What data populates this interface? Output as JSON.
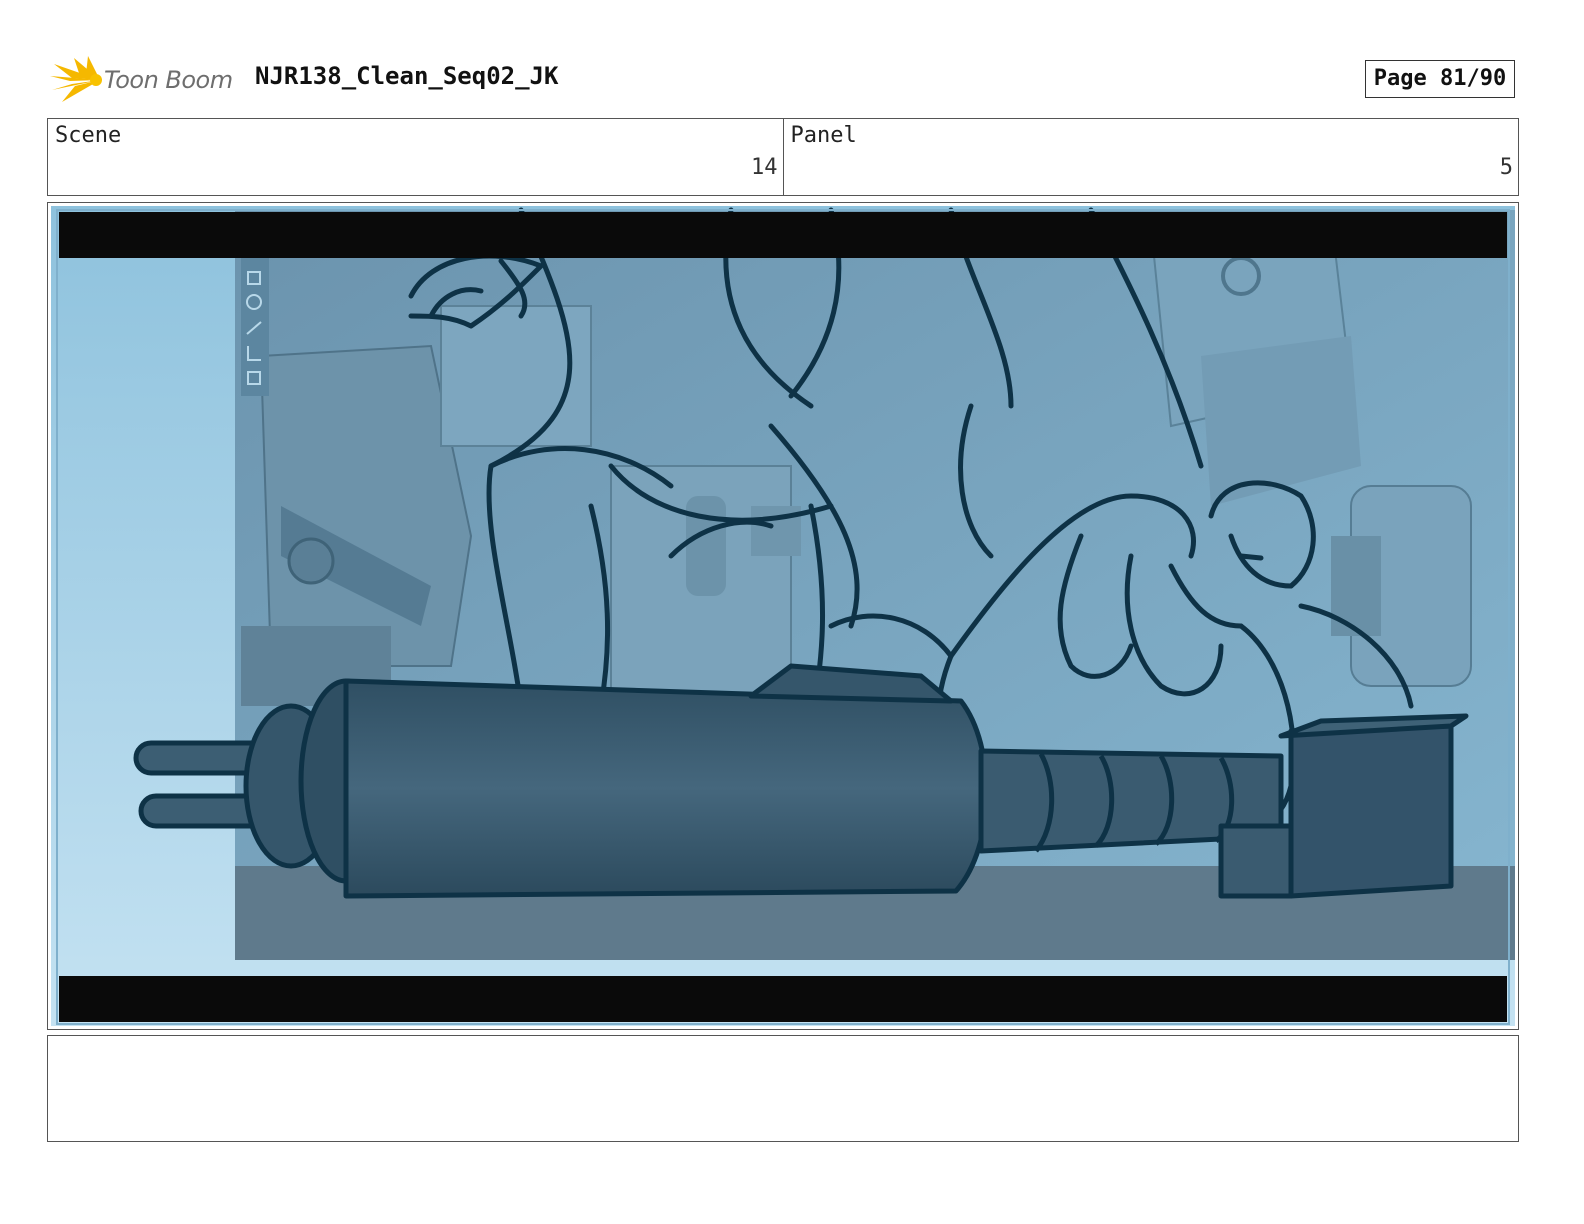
{
  "header": {
    "logo_text": "Toon Boom",
    "project_title": "NJR138_Clean_Seq02_JK",
    "page_label": "Page 81/90"
  },
  "info": {
    "scene_label": "Scene",
    "scene_value": "14",
    "panel_label": "Panel",
    "panel_value": "5"
  },
  "notes": {
    "text": ""
  },
  "colors": {
    "logo_accent": "#f5b800",
    "letterbox": "#0a0a0a",
    "sky_light": "#c4e2f2",
    "sky_mid": "#8ec2dd",
    "panel_tint": "#6d9ab4",
    "ink": "#0e3246",
    "cylinder": "#3c5e73"
  }
}
